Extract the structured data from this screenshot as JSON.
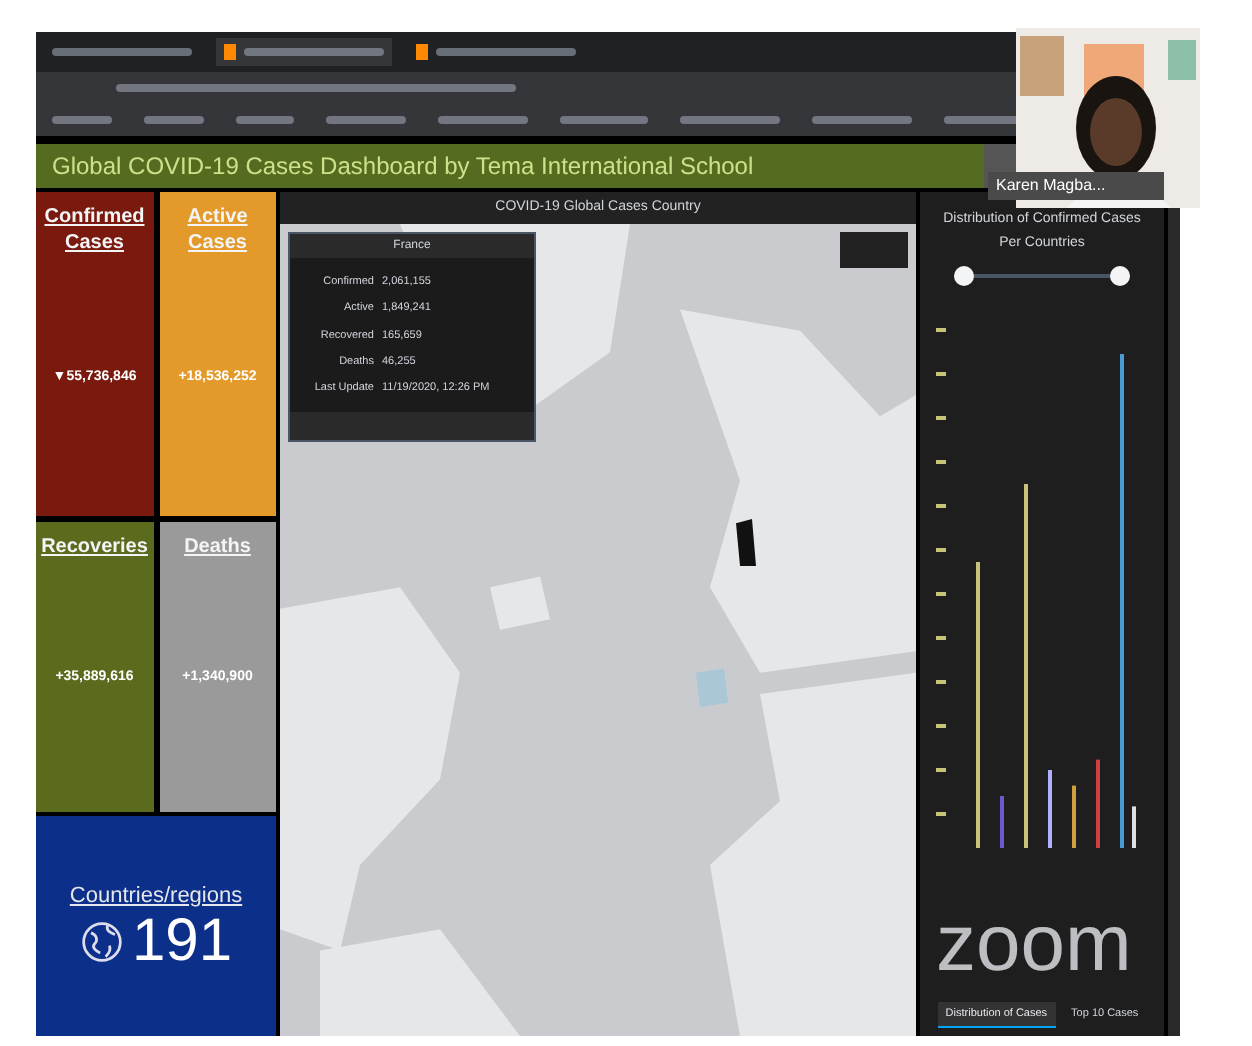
{
  "header": {
    "title": "Global COVID-19 Cases Dashboard by Tema International School"
  },
  "participant": {
    "name": "Karen Magba..."
  },
  "cards": [
    {
      "title": "Confirmed Cases",
      "value": "▼55,736,846",
      "color": "#7a1a0e"
    },
    {
      "title": "Active Cases",
      "value": "+18,536,252",
      "color": "#e39a2a"
    },
    {
      "title": "Recoveries",
      "value": "+35,889,616",
      "color": "#5a6b1e"
    },
    {
      "title": "Deaths",
      "value": "+1,340,900",
      "color": "#9a9a9a"
    }
  ],
  "countries": {
    "title": "Countries/regions",
    "value": "191"
  },
  "map": {
    "title": "COVID-19 Global Cases Country",
    "popup": {
      "title": "France",
      "rows": [
        {
          "label": "Confirmed",
          "value": "2,061,155"
        },
        {
          "label": "Active",
          "value": "1,849,241"
        },
        {
          "label": "Recovered",
          "value": "165,659"
        },
        {
          "label": "Deaths",
          "value": "46,255"
        },
        {
          "label": "Last Update",
          "value": "11/19/2020, 12:26 PM"
        }
      ]
    }
  },
  "chart": {
    "title": "Distribution of Confirmed Cases Per Countries",
    "tabs": [
      {
        "label": "Distribution of Cases",
        "selected": true
      },
      {
        "label": "Top 10 Cases",
        "selected": false
      }
    ]
  },
  "overlay": {
    "logo": "zoom"
  }
}
